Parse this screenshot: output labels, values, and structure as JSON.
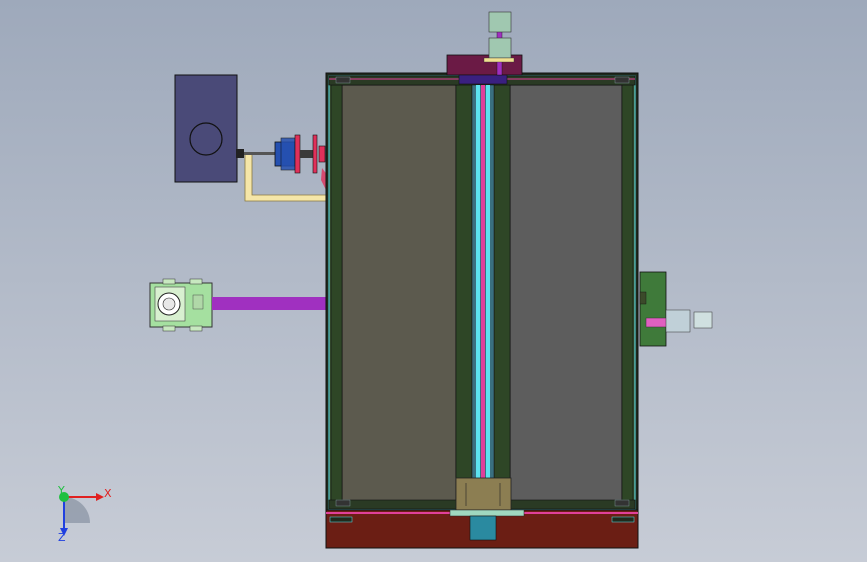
{
  "viewport": {
    "background_top": "#9ea9bb",
    "background_bottom": "#c7ccd6"
  },
  "colors": {
    "frame_dark": "#2f3a2a",
    "panel_left": "#5c5a4e",
    "panel_right": "#5d5d5d",
    "frame_green": "#3d5a35",
    "rail_cyan": "#5de3ef",
    "rail_magenta": "#e0409a",
    "bottom_base": "#6b1e14",
    "top_block": "#6b1a45",
    "purple_rod": "#a030c0",
    "motor_box": "#4a4a78",
    "pneumatic_cyl": "#2550b0",
    "flange_red": "#e0305a",
    "pipe_yellow": "#f5e6a8",
    "gearbox_green": "#a5e0a0",
    "side_plate_green": "#3f7a3a"
  },
  "triad": {
    "x_label": "X",
    "y_label": "Y",
    "z_label": "Z",
    "x_color": "#e02020",
    "y_color": "#20c040",
    "z_color": "#2040e0"
  }
}
